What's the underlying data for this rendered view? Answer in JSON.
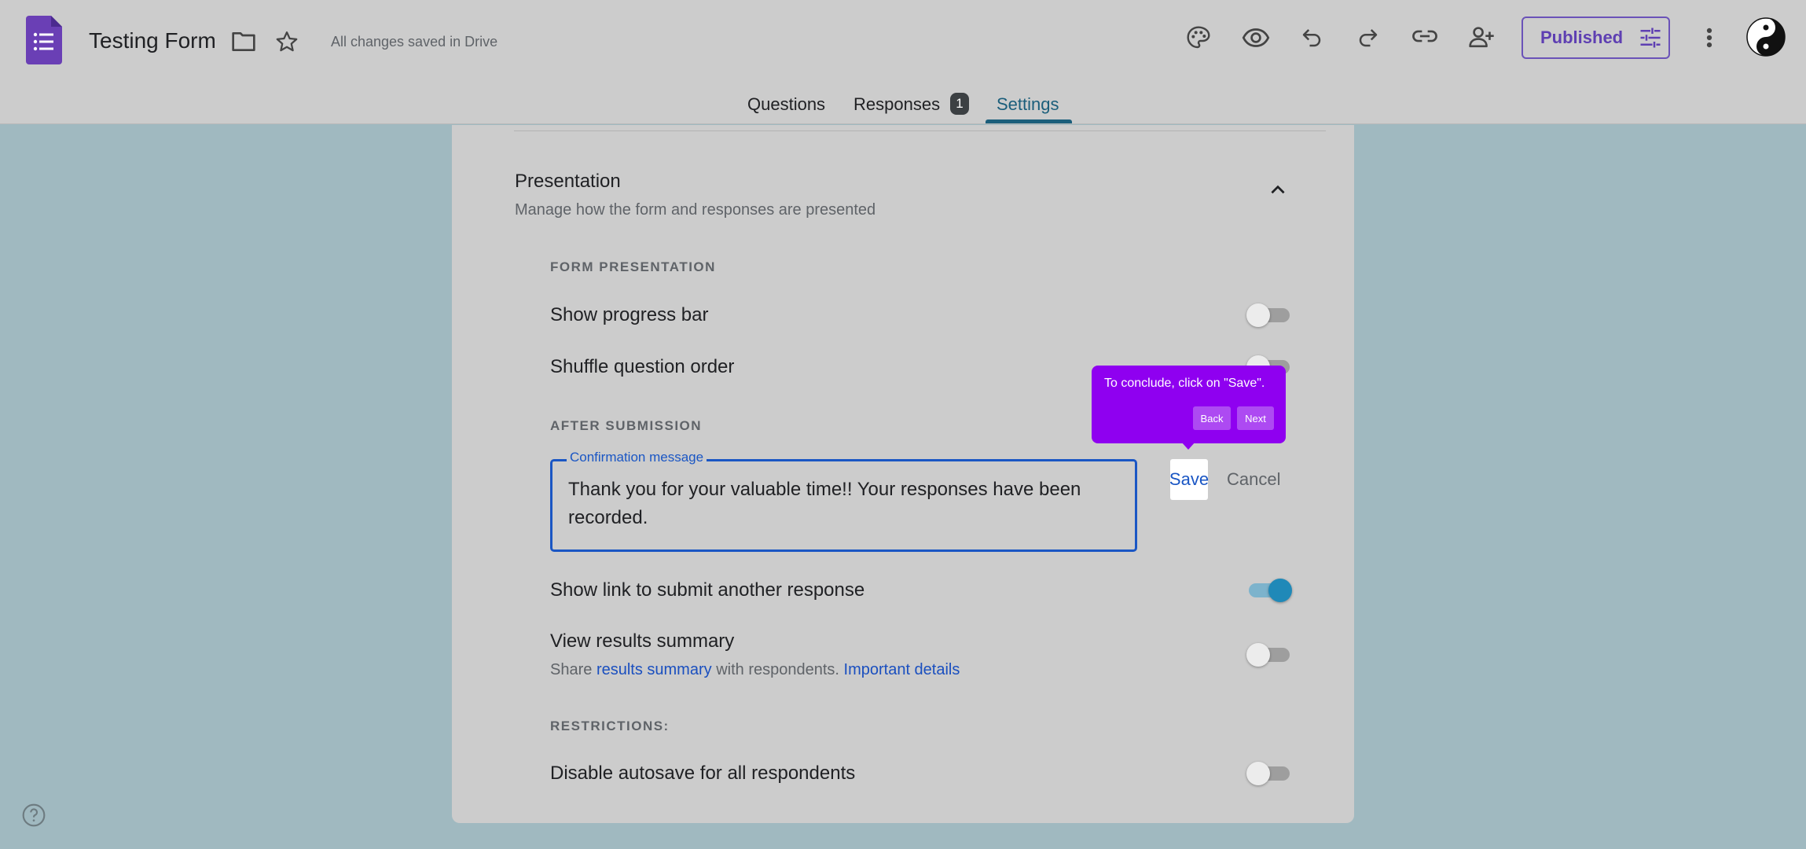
{
  "header": {
    "form_title": "Testing Form",
    "save_status": "All changes saved in Drive",
    "publish_label": "Published"
  },
  "tabs": [
    {
      "label": "Questions"
    },
    {
      "label": "Responses"
    },
    {
      "label": "Settings"
    }
  ],
  "responses_count": "1",
  "presentation": {
    "title": "Presentation",
    "subtitle": "Manage how the form and responses are presented",
    "form_presentation_caption": "FORM PRESENTATION",
    "show_progress_bar": "Show progress bar",
    "shuffle_question_order": "Shuffle question order",
    "after_submission_caption": "AFTER SUBMISSION",
    "confirmation_label": "Confirmation message",
    "confirmation_text": "Thank you for your valuable time!! Your responses have been recorded.",
    "save_label": "Save",
    "cancel_label": "Cancel",
    "show_link": "Show link to submit another response",
    "view_results": "View results summary",
    "share_prefix": "Share ",
    "results_summary_link": "results summary",
    "share_middle": " with respondents. ",
    "important_details_link": "Important details",
    "restrictions_caption": "RESTRICTIONS:",
    "disable_autosave": "Disable autosave for all respondents"
  },
  "toggles": {
    "show_progress_bar": false,
    "shuffle_question_order": false,
    "show_link": true,
    "view_results": false,
    "disable_autosave": false
  },
  "tour": {
    "text": "To conclude, click on \"Save\".",
    "back_label": "Back",
    "next_label": "Next"
  },
  "colors": {
    "accent_purple": "#5e3fb2",
    "tour_purple": "#8f00f0",
    "link_blue": "#1a4fbf",
    "focus_blue": "#1a56c4",
    "toggle_on": "#1f89b8"
  },
  "icons": [
    "forms-logo-icon",
    "folder-icon",
    "star-icon",
    "palette-icon",
    "eye-icon",
    "undo-icon",
    "redo-icon",
    "link-icon",
    "add-person-icon",
    "tune-icon",
    "more-vert-icon",
    "avatar",
    "chevron-up-icon",
    "help-icon"
  ]
}
